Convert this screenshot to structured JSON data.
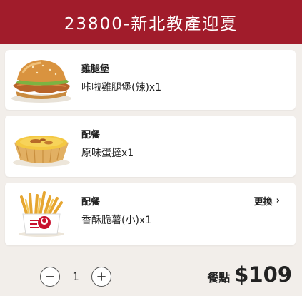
{
  "header": {
    "title": "23800-新北教產迎夏"
  },
  "items": [
    {
      "title": "雞腿堡",
      "desc": "咔啦雞腿堡(辣)x1",
      "image": "chicken-burger-image"
    },
    {
      "title": "配餐",
      "desc": "原味蛋撻x1",
      "image": "egg-tart-image"
    },
    {
      "title": "配餐",
      "desc": "香酥脆薯(小)x1",
      "image": "french-fries-image",
      "action": "更換"
    }
  ],
  "quantity": {
    "value": "1",
    "minus_icon": "minus-icon",
    "plus_icon": "plus-icon"
  },
  "price": {
    "label": "餐點",
    "value": "$109"
  },
  "colors": {
    "header": "#a11c2b",
    "background": "#f2eeea"
  }
}
